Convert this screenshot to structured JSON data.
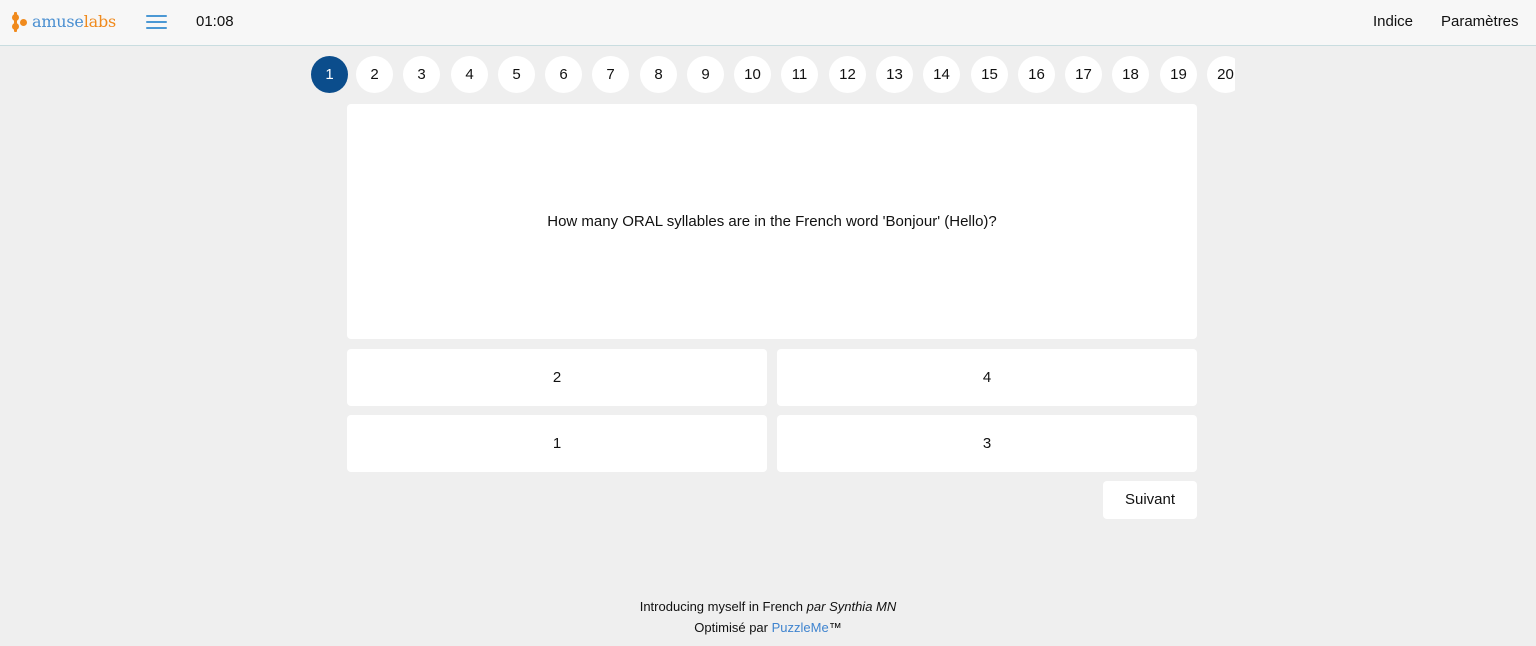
{
  "header": {
    "logo_part1": "amuse",
    "logo_part2": "labs",
    "timer": "01:08",
    "hint_label": "Indice",
    "settings_label": "Paramètres",
    "colors": {
      "logo_blue": "#4a8fd1",
      "logo_orange": "#f08a1d",
      "accent": "#0b4d8c"
    },
    "icons": [
      "logo-icon",
      "menu-icon"
    ]
  },
  "question_nav": {
    "items": [
      "1",
      "2",
      "3",
      "4",
      "5",
      "6",
      "7",
      "8",
      "9",
      "10",
      "11",
      "12",
      "13",
      "14",
      "15",
      "16",
      "17",
      "18",
      "19",
      "20"
    ],
    "active": "1"
  },
  "question": {
    "text": "How many ORAL syllables are in the French word 'Bonjour' (Hello)?",
    "answers": [
      "2",
      "4",
      "1",
      "3"
    ]
  },
  "next_label": "Suivant",
  "footer": {
    "title": "Introducing myself in French",
    "par": "par",
    "author": "Synthia MN",
    "powered_prefix": "Optimisé par",
    "powered_brand": "PuzzleMe",
    "tm": "™"
  }
}
